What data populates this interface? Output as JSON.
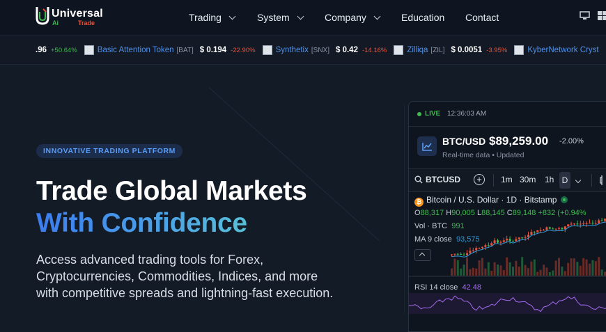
{
  "brand": {
    "name": "Universal",
    "sub_ai": "Ai",
    "sub_trade": "Trade",
    "colors": {
      "green": "#3fb950",
      "red": "#e5533c"
    }
  },
  "nav": {
    "items": [
      {
        "label": "Trading",
        "dropdown": true
      },
      {
        "label": "System",
        "dropdown": true
      },
      {
        "label": "Company",
        "dropdown": true
      },
      {
        "label": "Education",
        "dropdown": false
      },
      {
        "label": "Contact",
        "dropdown": false
      }
    ],
    "icons": [
      "desktop-icon",
      "windows-icon"
    ]
  },
  "ticker": {
    "lead": {
      "price": ".96",
      "change": "+50.64%"
    },
    "items": [
      {
        "name": "Basic Attention Token",
        "symbol": "[BAT]",
        "price": "$ 0.194",
        "change": "-22.90%"
      },
      {
        "name": "Synthetix",
        "symbol": "[SNX]",
        "price": "$ 0.42",
        "change": "-14.16%"
      },
      {
        "name": "Zilliqa",
        "symbol": "[ZIL]",
        "price": "$ 0.0051",
        "change": "-3.95%"
      },
      {
        "name": "KyberNetwork Cryst",
        "symbol": "",
        "price": "",
        "change": ""
      }
    ]
  },
  "hero": {
    "badge": "INNOVATIVE TRADING PLATFORM",
    "title_line1": "Trade Global Markets",
    "title_line2": "With Confidence",
    "description": "Access advanced trading tools for Forex, Cryptocurrencies, Commodities, Indices, and more with competitive spreads and lightning-fast execution."
  },
  "chart_card": {
    "live_label": "LIVE",
    "time": "12:36:03 AM",
    "pair": "BTC/USD",
    "price": "$89,259.00",
    "change": "-2.00%",
    "sub": "Real-time data  •  Updated",
    "toolbar": {
      "symbol": "BTCUSD",
      "plus": "+",
      "intervals": [
        "1m",
        "30m",
        "1h",
        "D"
      ]
    },
    "legend": {
      "title": "Bitcoin / U.S. Dollar · 1D · Bitstamp",
      "o_label": "O",
      "o": "88,317",
      "h_label": "H",
      "h": "90,005",
      "l_label": "L",
      "l": "88,145",
      "c_label": "C",
      "c": "89,148",
      "chg": "+832 (+0.94%",
      "vol_label": "Vol · BTC",
      "vol": "991",
      "ma_label": "MA 9 close",
      "ma": "93,575",
      "rsi_label": "RSI 14 close",
      "rsi": "42.48"
    }
  }
}
